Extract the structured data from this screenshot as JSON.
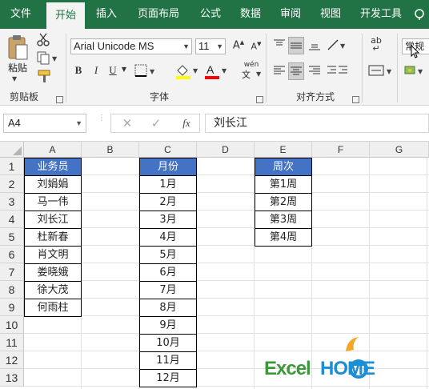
{
  "ribbon_tabs": [
    "文件",
    "开始",
    "插入",
    "页面布局",
    "公式",
    "数据",
    "审阅",
    "视图",
    "开发工具"
  ],
  "active_tab": "开始",
  "clipboard": {
    "paste_label": "粘贴",
    "group_label": "剪贴板"
  },
  "font": {
    "name": "Arial Unicode MS",
    "size": "11",
    "group_label": "字体",
    "bold": "B",
    "italic": "I",
    "underline": "U",
    "phonetic": "wén"
  },
  "alignment": {
    "group_label": "对齐方式"
  },
  "number": {
    "format": "常规"
  },
  "formula_bar": {
    "name_box": "A4",
    "fx": "fx",
    "content": "刘长江"
  },
  "columns": [
    "A",
    "B",
    "C",
    "D",
    "E",
    "F",
    "G"
  ],
  "rows": [
    "1",
    "2",
    "3",
    "4",
    "5",
    "6",
    "7",
    "8",
    "9",
    "10",
    "11",
    "12",
    "13"
  ],
  "table_salesperson": {
    "header": "业务员",
    "values": [
      "刘娟娟",
      "马一伟",
      "刘长江",
      "杜新春",
      "肖文明",
      "娄晓娥",
      "徐大茂",
      "何雨柱"
    ]
  },
  "table_month": {
    "header": "月份",
    "values": [
      "1月",
      "2月",
      "3月",
      "4月",
      "5月",
      "6月",
      "7月",
      "8月",
      "9月",
      "10月",
      "11月",
      "12月"
    ]
  },
  "table_week": {
    "header": "周次",
    "values": [
      "第1周",
      "第2周",
      "第3周",
      "第4周"
    ]
  },
  "watermark": {
    "text1": "Excel",
    "text2": "HOME"
  },
  "colors": {
    "ribbon_green": "#217346",
    "header_blue": "#4472c4",
    "logo_green": "#3a9a3a",
    "logo_blue": "#1a8fd6",
    "logo_orange": "#f5a623"
  }
}
